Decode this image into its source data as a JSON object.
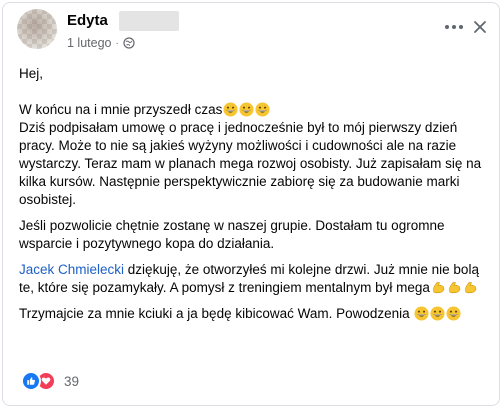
{
  "post": {
    "author": "Edyta",
    "timestamp": "1 lutego",
    "separator": "·",
    "privacy_icon": "globe-icon"
  },
  "content": {
    "greeting": "Hej,",
    "p1_line1": "W końcu na i mnie przyszedł czas",
    "p1_rest": "Dziś podpisałam umowę o pracę i jednocześnie był to mój pierwszy dzień pracy. Może to nie są jakieś wyżyny możliwości i cudowności ale na razie wystarczy. Teraz mam w planach mega rozwoj osobisty. Już zapisałam się na kilka kursów. Następnie perspektywicznie zabiorę się za budowanie marki osobistej.",
    "p2": "Jeśli pozwolicie chętnie zostanę w naszej grupie. Dostałam tu ogromne wsparcie i pozytywnego kopa do działania.",
    "p3_mention": "Jacek Chmielecki",
    "p3_text": " dziękuję,  że otworzyłeś mi kolejne drzwi. Już mnie nie bolą te, które się pozamykały. A pomysł z treningiem mentalnym był mega",
    "p4": "Trzymajcie za mnie kciuki a ja będę kibicować Wam. Powodzenia "
  },
  "reactions": {
    "count": "39",
    "types": [
      "like-icon",
      "love-icon"
    ]
  },
  "colors": {
    "link": "#1d5fc6",
    "meta": "#65676b",
    "like": "#1877f2",
    "love": "#f33e58"
  }
}
